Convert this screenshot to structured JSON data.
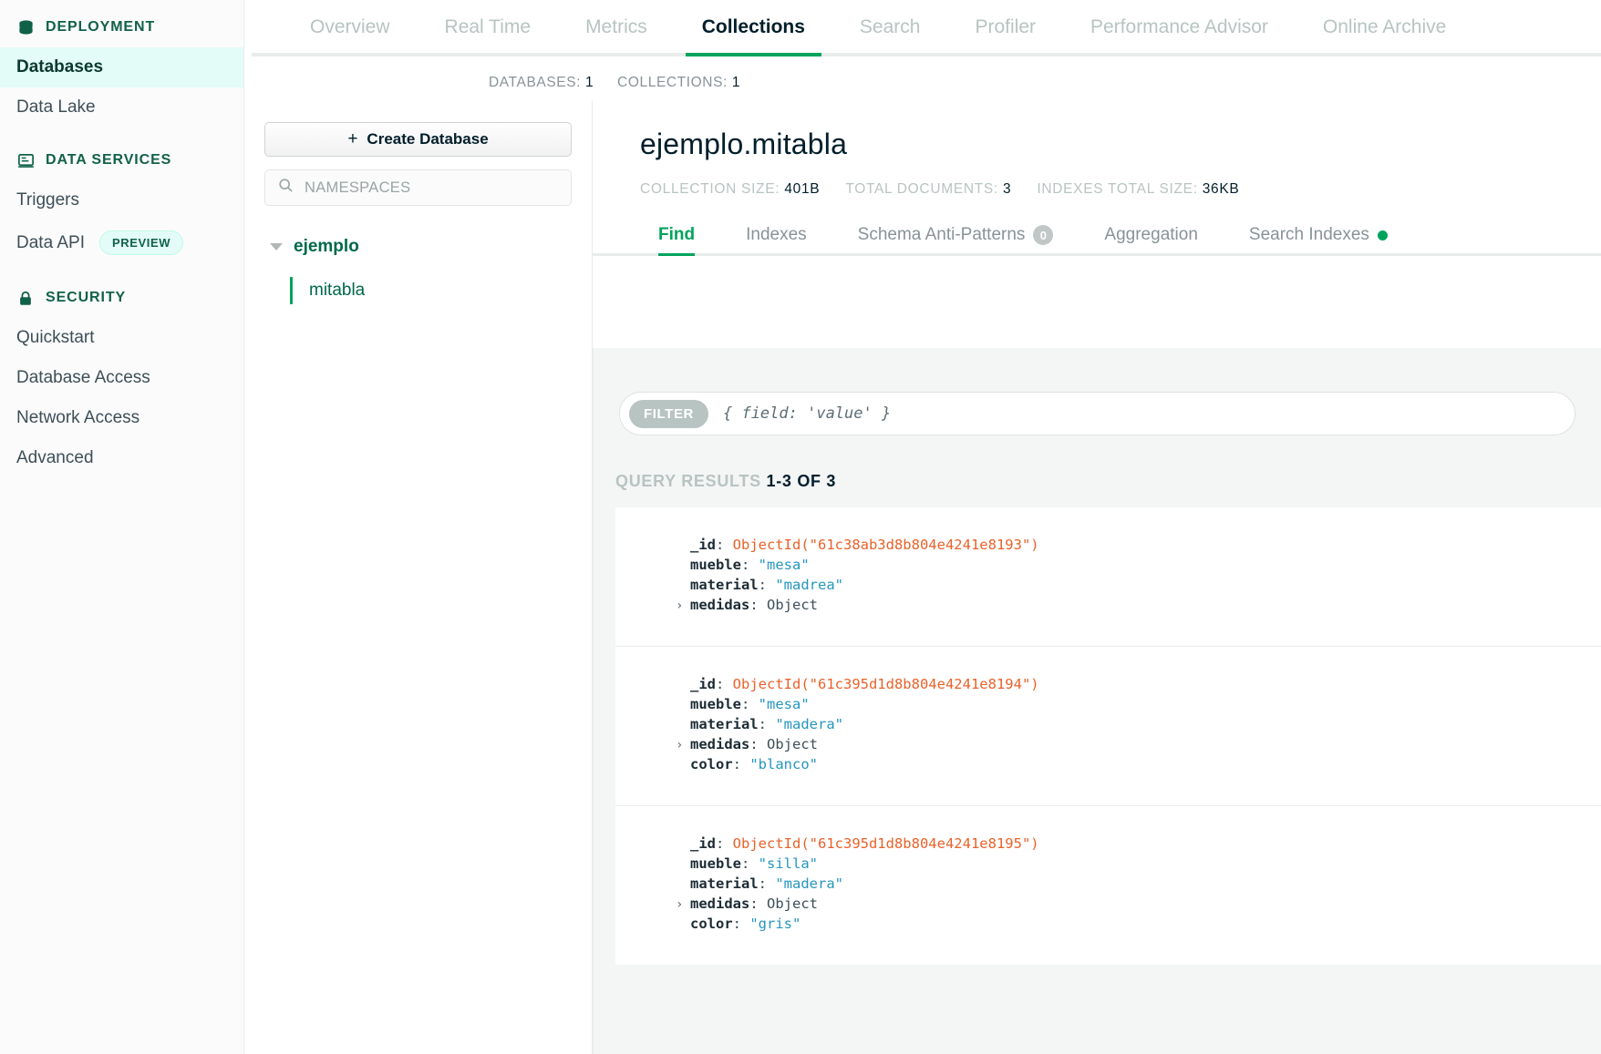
{
  "sidebar": {
    "groups": [
      {
        "icon": "database-icon",
        "label": "DEPLOYMENT"
      },
      {
        "icon": "data-services-icon",
        "label": "DATA SERVICES"
      },
      {
        "icon": "lock-icon",
        "label": "SECURITY"
      }
    ],
    "deployment_items": [
      {
        "label": "Databases",
        "active": true
      },
      {
        "label": "Data Lake",
        "active": false
      }
    ],
    "data_services_items": [
      {
        "label": "Triggers",
        "badge": ""
      },
      {
        "label": "Data API",
        "badge": "PREVIEW"
      }
    ],
    "security_items": [
      {
        "label": "Quickstart"
      },
      {
        "label": "Database Access"
      },
      {
        "label": "Network Access"
      },
      {
        "label": "Advanced"
      }
    ]
  },
  "topnav": {
    "tabs": [
      {
        "label": "Overview",
        "active": false
      },
      {
        "label": "Real Time",
        "active": false
      },
      {
        "label": "Metrics",
        "active": false
      },
      {
        "label": "Collections",
        "active": true
      },
      {
        "label": "Search",
        "active": false
      },
      {
        "label": "Profiler",
        "active": false
      },
      {
        "label": "Performance Advisor",
        "active": false
      },
      {
        "label": "Online Archive",
        "active": false
      }
    ]
  },
  "counts": {
    "databases_label": "DATABASES:",
    "databases_value": "1",
    "collections_label": "COLLECTIONS:",
    "collections_value": "1"
  },
  "namespaces": {
    "create_button": "Create Database",
    "create_plus": "+",
    "search_placeholder": "NAMESPACES",
    "database_name": "ejemplo",
    "collection_name": "mitabla"
  },
  "collection": {
    "title": "ejemplo.mitabla",
    "stats": [
      {
        "label": "COLLECTION SIZE:",
        "value": "401B"
      },
      {
        "label": "TOTAL DOCUMENTS:",
        "value": "3"
      },
      {
        "label": "INDEXES TOTAL SIZE:",
        "value": "36KB"
      }
    ],
    "subtabs": [
      {
        "label": "Find",
        "active": true,
        "badge": "",
        "dot": false
      },
      {
        "label": "Indexes",
        "active": false,
        "badge": "",
        "dot": false
      },
      {
        "label": "Schema Anti-Patterns",
        "active": false,
        "badge": "0",
        "dot": false
      },
      {
        "label": "Aggregation",
        "active": false,
        "badge": "",
        "dot": false
      },
      {
        "label": "Search Indexes",
        "active": false,
        "badge": "",
        "dot": true
      }
    ]
  },
  "filter": {
    "pill_label": "FILTER",
    "placeholder": "{ field: 'value' }"
  },
  "results": {
    "label": "QUERY RESULTS",
    "range": "1-3 OF 3",
    "documents": [
      {
        "fields": [
          {
            "key": "_id",
            "value": "ObjectId(\"61c38ab3d8b804e4241e8193\")",
            "kind": "objectid",
            "expandable": false
          },
          {
            "key": "mueble",
            "value": "\"mesa\"",
            "kind": "string",
            "expandable": false
          },
          {
            "key": "material",
            "value": "\"madrea\"",
            "kind": "string",
            "expandable": false
          },
          {
            "key": "medidas",
            "value": "Object",
            "kind": "object",
            "expandable": true
          }
        ]
      },
      {
        "fields": [
          {
            "key": "_id",
            "value": "ObjectId(\"61c395d1d8b804e4241e8194\")",
            "kind": "objectid",
            "expandable": false
          },
          {
            "key": "mueble",
            "value": "\"mesa\"",
            "kind": "string",
            "expandable": false
          },
          {
            "key": "material",
            "value": "\"madera\"",
            "kind": "string",
            "expandable": false
          },
          {
            "key": "medidas",
            "value": "Object",
            "kind": "object",
            "expandable": true
          },
          {
            "key": "color",
            "value": "\"blanco\"",
            "kind": "string",
            "expandable": false
          }
        ]
      },
      {
        "fields": [
          {
            "key": "_id",
            "value": "ObjectId(\"61c395d1d8b804e4241e8195\")",
            "kind": "objectid",
            "expandable": false
          },
          {
            "key": "mueble",
            "value": "\"silla\"",
            "kind": "string",
            "expandable": false
          },
          {
            "key": "material",
            "value": "\"madera\"",
            "kind": "string",
            "expandable": false
          },
          {
            "key": "medidas",
            "value": "Object",
            "kind": "object",
            "expandable": true
          },
          {
            "key": "color",
            "value": "\"gris\"",
            "kind": "string",
            "expandable": false
          }
        ]
      }
    ]
  },
  "colors": {
    "accent_green": "#00a35c",
    "dark_green": "#00684a",
    "text_dark": "#001e2b",
    "muted": "#889397"
  }
}
